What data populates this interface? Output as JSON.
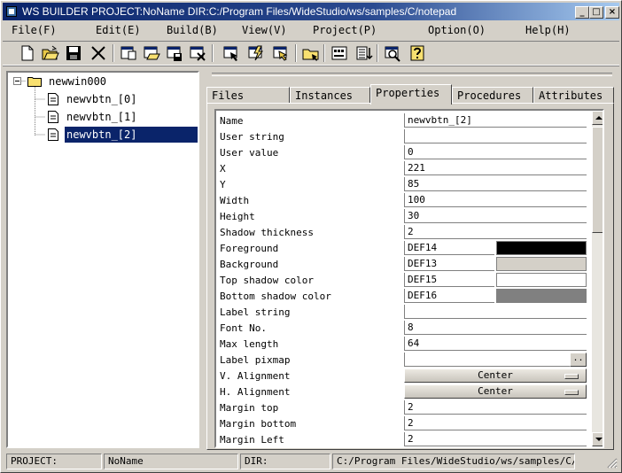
{
  "window": {
    "title": "WS BUILDER PROJECT:NoName DIR:C:/Program Files/WideStudio/ws/samples/C/notepad",
    "controls": {
      "minimize": "_",
      "maximize": "□",
      "close": "×"
    }
  },
  "menu": [
    "File(F)",
    "Edit(E)",
    "Build(B)",
    "View(V)",
    "Project(P)",
    "Option(O)",
    "Help(H)"
  ],
  "toolbar_icons": [
    "new-file-icon",
    "open-folder-icon",
    "save-disk-icon",
    "cut-icon",
    "new-window-icon",
    "open-window-icon",
    "save-window-icon",
    "close-window-icon",
    "select-icon",
    "build-icon",
    "run-icon",
    "folder-icon",
    "form-icon",
    "list-icon",
    "preview-icon",
    "help-icon"
  ],
  "tree": {
    "root": "newwin000",
    "children": [
      "newvbtn_[0]",
      "newvbtn_[1]",
      "newvbtn_[2]"
    ],
    "selected_index": 2
  },
  "tabs": [
    "Files",
    "Instances",
    "Properties",
    "Procedures",
    "Attributes"
  ],
  "active_tab": "Properties",
  "properties": [
    {
      "label": "Name",
      "value": "newvbtn_[2]"
    },
    {
      "label": "User string",
      "value": ""
    },
    {
      "label": "User value",
      "value": "0"
    },
    {
      "label": "X",
      "value": "221"
    },
    {
      "label": "Y",
      "value": "85"
    },
    {
      "label": "Width",
      "value": "100"
    },
    {
      "label": "Height",
      "value": "30"
    },
    {
      "label": "Shadow thickness",
      "value": "2"
    },
    {
      "label": "Foreground",
      "value": "DEF14",
      "color": "#000000"
    },
    {
      "label": "Background",
      "value": "DEF13",
      "color": "#d4d0c8"
    },
    {
      "label": "Top shadow color",
      "value": "DEF15",
      "color": "#ffffff"
    },
    {
      "label": "Bottom shadow color",
      "value": "DEF16",
      "color": "#808080"
    },
    {
      "label": "Label string",
      "value": ""
    },
    {
      "label": "Font No.",
      "value": "8"
    },
    {
      "label": "Max length",
      "value": "64"
    },
    {
      "label": "Label pixmap",
      "value": "",
      "button": ".."
    },
    {
      "label": "V. Alignment",
      "option": "Center"
    },
    {
      "label": "H. Alignment",
      "option": "Center"
    },
    {
      "label": "Margin top",
      "value": "2"
    },
    {
      "label": "Margin bottom",
      "value": "2"
    },
    {
      "label": "Margin Left",
      "value": "2"
    }
  ],
  "status": {
    "project_label": "PROJECT:",
    "project_value": "NoName",
    "dir_label": "DIR:",
    "dir_value": "C:/Program Files/WideStudio/ws/samples/C/notepad"
  },
  "colors": {
    "titlebar": "#0a246a",
    "selection": "#0a246a",
    "face": "#d4d0c8"
  }
}
